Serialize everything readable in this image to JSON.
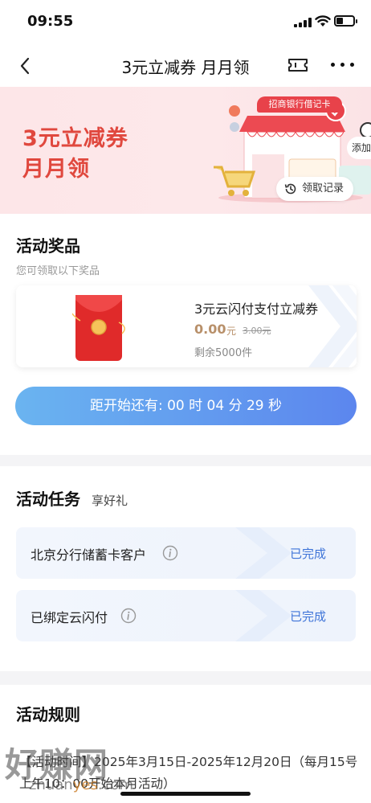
{
  "status_bar": {
    "time": "09:55"
  },
  "nav": {
    "title": "3元立减券 月月领"
  },
  "banner": {
    "title_line1": "3元立减券",
    "title_line2": "月月领",
    "shop_sign": "招商银行借记卡",
    "records_button": "领取记录",
    "add_bubble": "添加"
  },
  "prizes": {
    "title": "活动奖品",
    "subtitle": "您可领取以下奖品",
    "items": [
      {
        "name": "3元云闪付支付立减券",
        "price": "0.00",
        "unit": "元",
        "original_price": "3.00元",
        "stock": "剩余5000件"
      }
    ],
    "countdown": "距开始还有: 00 时 04 分 29 秒"
  },
  "tasks": {
    "title": "活动任务",
    "subtitle": "享好礼",
    "items": [
      {
        "label": "北京分行储蓄卡客户",
        "status": "已完成"
      },
      {
        "label": "已绑定云闪付",
        "status": "已完成"
      }
    ]
  },
  "rules": {
    "title": "活动规则",
    "text": "【活动时间】2025年3月15日-2025年12月20日（每月15号上午10：00开始本月活动）"
  },
  "watermark": {
    "logo": "好赚网",
    "url_part1": "zhuan",
    "url_part2": "yes",
    "url_part3": ".com"
  },
  "colors": {
    "accent_red": "#e0483e",
    "price_gold": "#b8906a",
    "status_blue": "#3e74d8",
    "button_gradient_start": "#6ab4f0",
    "button_gradient_end": "#5c86ee"
  }
}
